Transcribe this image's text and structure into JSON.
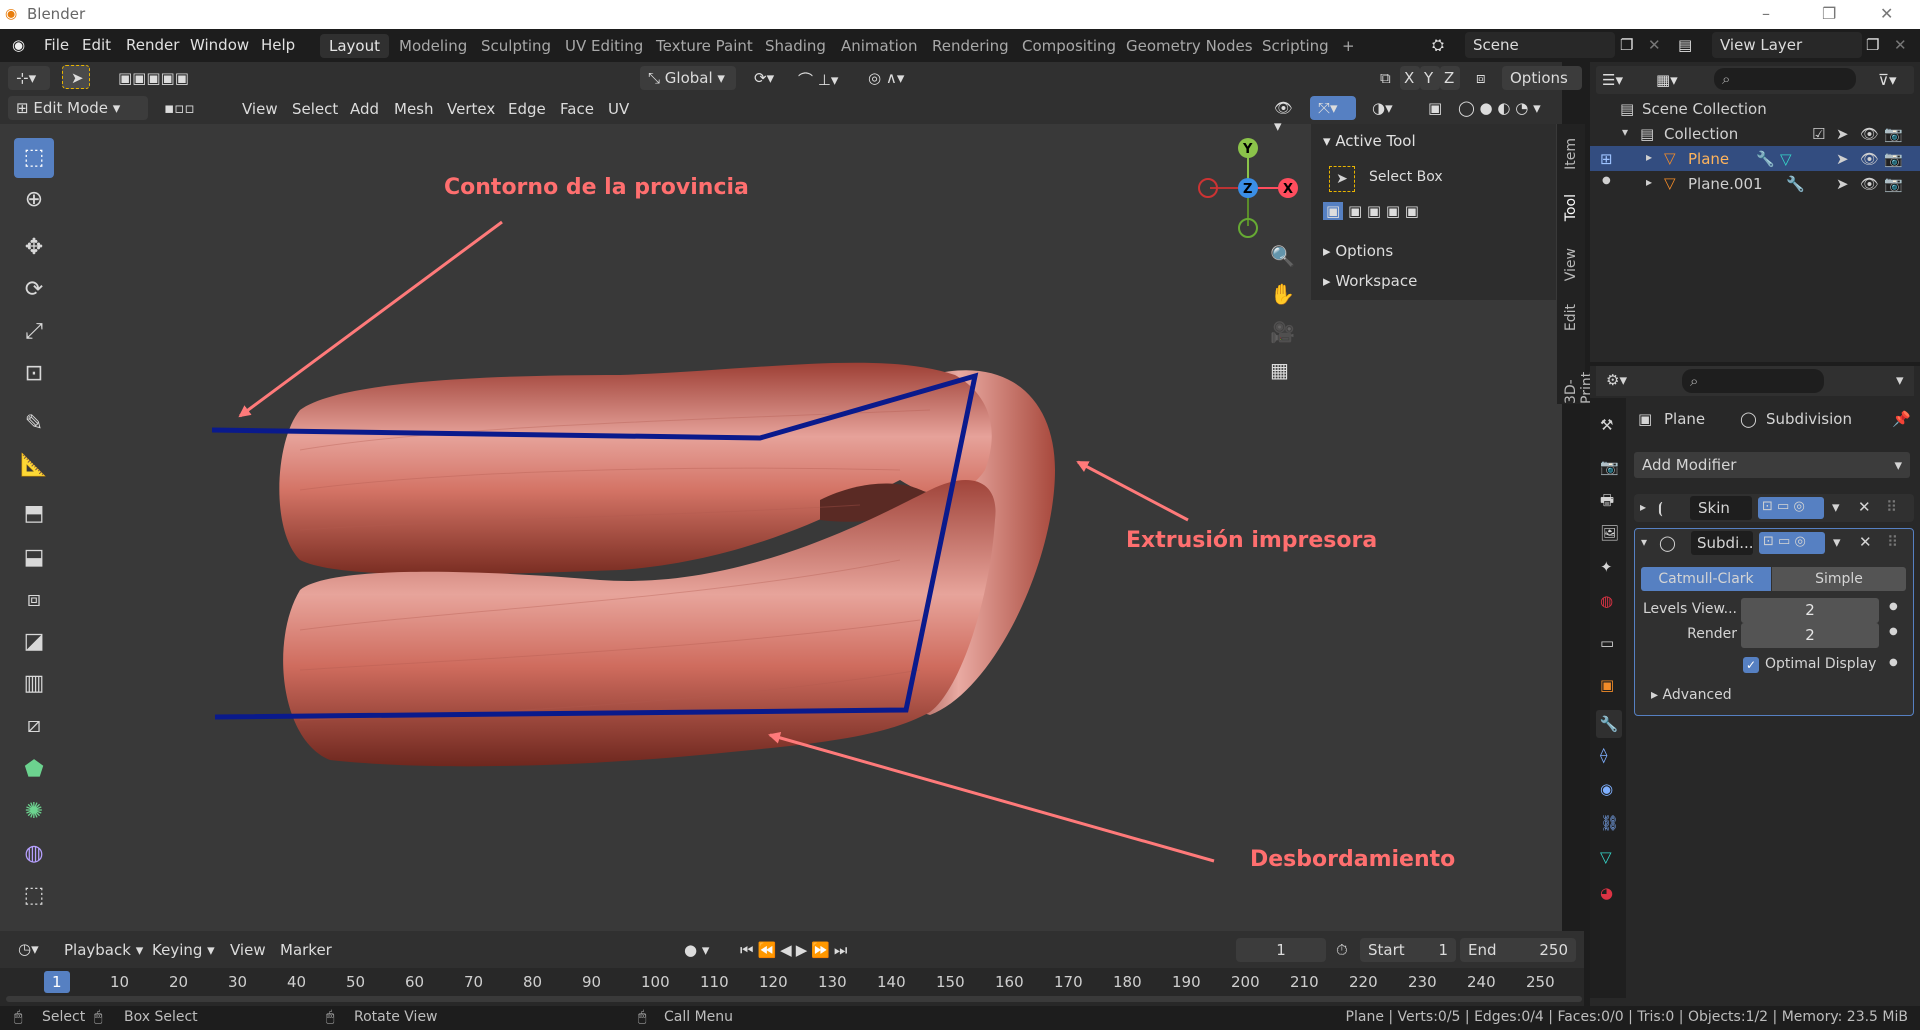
{
  "titlebar": {
    "app_title": "Blender",
    "controls": [
      "–",
      "❐",
      "✕"
    ]
  },
  "menubar": {
    "items": [
      "File",
      "Edit",
      "Render",
      "Window",
      "Help"
    ],
    "workspaces": [
      "Layout",
      "Modeling",
      "Sculpting",
      "UV Editing",
      "Texture Paint",
      "Shading",
      "Animation",
      "Rendering",
      "Compositing",
      "Geometry Nodes",
      "Scripting",
      "+"
    ],
    "active_workspace": "Layout",
    "scene": "Scene",
    "view_layer": "View Layer"
  },
  "viewport_header": {
    "transform_orientation": "Global",
    "options": "Options",
    "axes": [
      "X",
      "Y",
      "Z"
    ],
    "mode": "Edit Mode",
    "menus": [
      "View",
      "Select",
      "Add",
      "Mesh",
      "Vertex",
      "Edge",
      "Face",
      "UV"
    ]
  },
  "npanel": {
    "active_tool_title": "Active Tool",
    "tool_name": "Select Box",
    "options": "Options",
    "workspace": "Workspace",
    "tabs": [
      "Item",
      "Tool",
      "View",
      "Edit",
      "3D-Print"
    ]
  },
  "annotations": {
    "contorno": "Contorno de la provincia",
    "extrusion": "Extrusión impresora",
    "desbordamiento": "Desbordamiento"
  },
  "outliner": {
    "scene_collection": "Scene Collection",
    "collection": "Collection",
    "objects": [
      "Plane",
      "Plane.001"
    ]
  },
  "properties": {
    "object": "Plane",
    "modifier": "Subdivision",
    "add_modifier": "Add Modifier",
    "mod_skin": "Skin",
    "mod_subdiv": "Subdi...",
    "catmull": "Catmull-Clark",
    "simple": "Simple",
    "levels_label": "Levels View...",
    "levels_value": "2",
    "render_label": "Render",
    "render_value": "2",
    "optimal_display": "Optimal Display",
    "advanced": "Advanced"
  },
  "timeline": {
    "menus": [
      "Playback",
      "Keying",
      "View",
      "Marker"
    ],
    "current_frame": "1",
    "start_label": "Start",
    "start": "1",
    "end_label": "End",
    "end": "250",
    "ruler": [
      "1",
      "10",
      "20",
      "30",
      "40",
      "50",
      "60",
      "70",
      "80",
      "90",
      "100",
      "110",
      "120",
      "130",
      "140",
      "150",
      "160",
      "170",
      "180",
      "190",
      "200",
      "210",
      "220",
      "230",
      "240",
      "250"
    ]
  },
  "statusbar": {
    "select": "Select",
    "box_select": "Box Select",
    "rotate_view": "Rotate View",
    "call_menu": "Call Menu",
    "stats": "Plane | Verts:0/5 | Edges:0/4 | Faces:0/0 | Tris:0 | Objects:1/2 | Memory: 23.5 MiB"
  },
  "colors": {
    "accent": "#5680c2",
    "annotation": "#ff6f6f",
    "tube": "#c8604f",
    "guide": "#0a1a8c"
  }
}
